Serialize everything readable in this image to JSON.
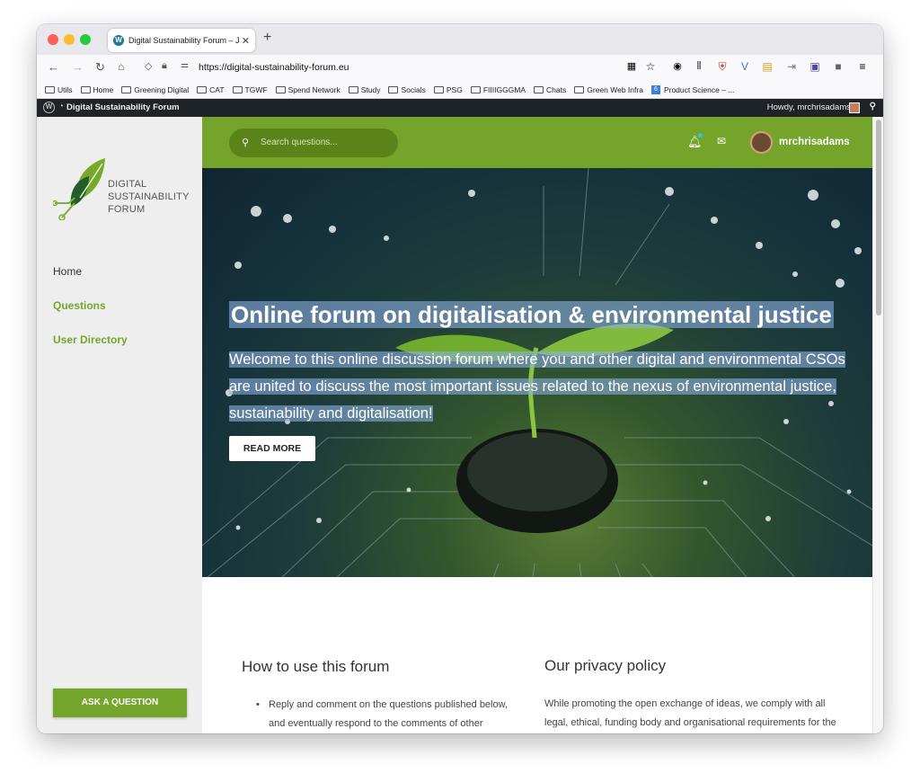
{
  "browser": {
    "tab_title": "Digital Sustainability Forum – Ju",
    "url": "https://digital-sustainability-forum.eu",
    "bookmarks": [
      "Utils",
      "Home",
      "Greening Digital",
      "CAT",
      "TGWF",
      "Spend Network",
      "Study",
      "Socials",
      "PSG",
      "FIIIIGGGMA",
      "Chats",
      "Green Web Infra",
      "Product Science – ..."
    ]
  },
  "admin_bar": {
    "site_name": "Digital Sustainability Forum",
    "greeting": "Howdy, mrchrisadams"
  },
  "sidebar": {
    "logo_text": [
      "DIGITAL",
      "SUSTAINABILITY",
      "FORUM"
    ],
    "nav": [
      {
        "label": "Home",
        "color": "#333333"
      },
      {
        "label": "Questions",
        "color": "#73a62a"
      },
      {
        "label": "User Directory",
        "color": "#73a62a"
      }
    ],
    "ask_button": "ASK A QUESTION"
  },
  "header": {
    "search_placeholder": "Search questions...",
    "username": "mrchrisadams"
  },
  "hero": {
    "title": "Online forum on digitalisation & environmental justice",
    "description": "Welcome to this online discussion forum where you and other digital and environmental CSOs are united to discuss the most important issues related to the nexus of environmental justice, sustainability and digitalisation!",
    "button": "READ MORE"
  },
  "sections": {
    "how_to": {
      "title": "How to use this forum",
      "items": [
        "Reply and comment on the questions published below, and eventually respond to the comments of other participants."
      ]
    },
    "privacy": {
      "title": "Our privacy policy",
      "text": "While promoting the open exchange of ideas, we comply with all legal, ethical, funding body and organisational requirements for the collection, use and storage of data."
    }
  },
  "colors": {
    "brand_green": "#74a42a",
    "admin_bar": "#1d2327"
  }
}
